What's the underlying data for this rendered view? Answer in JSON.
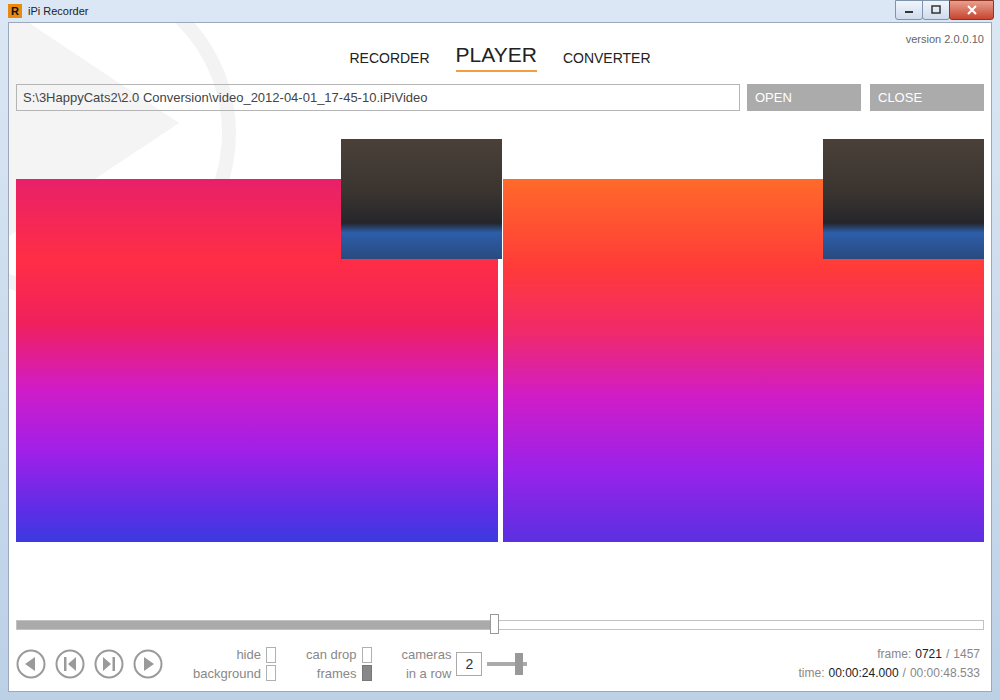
{
  "window": {
    "title": "iPi Recorder",
    "logo": "R"
  },
  "version": "version 2.0.0.10",
  "tabs": [
    {
      "label": "RECORDER",
      "selected": false
    },
    {
      "label": "PLAYER",
      "selected": true
    },
    {
      "label": "CONVERTER",
      "selected": false
    }
  ],
  "file": {
    "path": "S:\\3HappyCats2\\2.0 Conversion\\video_2012-04-01_17-45-10.iPiVideo",
    "buttons": [
      "OPEN",
      "CLOSE"
    ]
  },
  "timeline": {
    "level": 0.495
  },
  "options": [
    {
      "lines": [
        "hide",
        "background"
      ],
      "on": false
    },
    {
      "lines": [
        "can drop",
        "frames"
      ],
      "on": true
    }
  ],
  "cameras": {
    "lines": [
      "cameras",
      "in a row"
    ],
    "value": "2",
    "level": 0.8
  },
  "status": {
    "frame_label": "frame:",
    "frame": "0721",
    "separator": "/",
    "frame_total": "1457",
    "time_label": "time:",
    "time": "00:00:24.000",
    "duration": "00:00:48.533"
  }
}
